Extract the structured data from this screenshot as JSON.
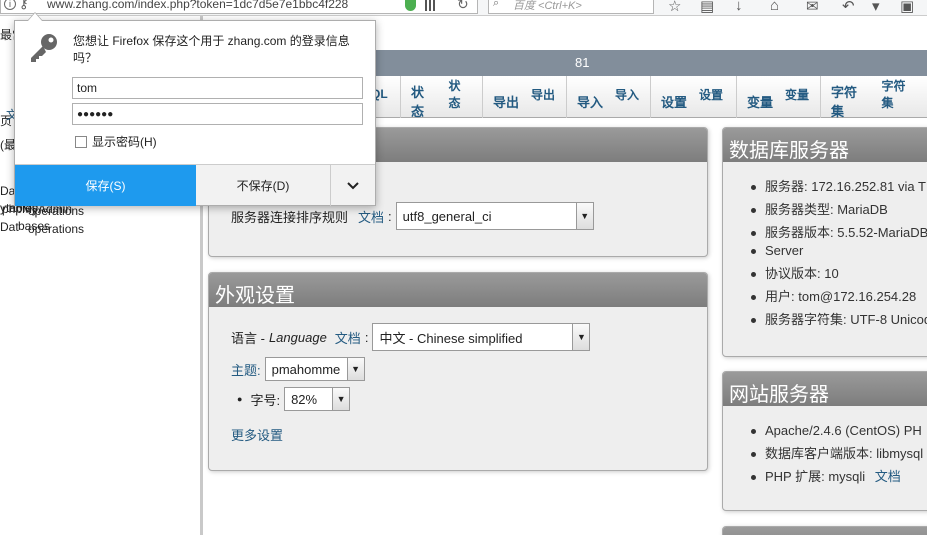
{
  "browser": {
    "url": "www.zhang.com/index.php?token=1dc7d5e7e1bbc4f228",
    "search_placeholder": "百度 <Ctrl+K>"
  },
  "nav": {
    "partial_texts": [
      "最常",
      "页",
      "文",
      "(最",
      "Dat",
      "ytables",
      "phpMyAdmin",
      "operations",
      "Dat",
      "operations",
      "bases"
    ]
  },
  "topbar": {
    "text": "81"
  },
  "tabs": [
    {
      "icon_text": "QL",
      "label": ""
    },
    {
      "icon_text": "状态",
      "label": "状态"
    },
    {
      "icon_text": "导出",
      "label": "导出"
    },
    {
      "icon_text": "导入",
      "label": "导入"
    },
    {
      "icon_text": "设置",
      "label": "设置"
    },
    {
      "icon_text": "变量",
      "label": "变量"
    },
    {
      "icon_text": "字符集",
      "label": "字符集"
    }
  ],
  "general_panel": {
    "collation_label": "服务器连接排序规则",
    "doc_link": "文档",
    "collation_value": "utf8_general_ci"
  },
  "appearance_panel": {
    "title": "外观设置",
    "language_label": "语言 - ",
    "language_label_en": "Language",
    "doc_link": "文档",
    "colon": ":",
    "language_value": "中文 - Chinese simplified",
    "theme_label": "主题:",
    "theme_value": "pmahomme",
    "font_label": "字号:",
    "font_value": "82%",
    "more_settings": "更多设置"
  },
  "db_server_panel": {
    "title": "数据库服务器",
    "items": [
      "服务器: 172.16.252.81 via T",
      "服务器类型: MariaDB",
      "服务器版本: 5.5.52-MariaDB",
      "Server",
      "协议版本: 10",
      "用户: tom@172.16.254.28",
      "服务器字符集: UTF-8 Unicod"
    ]
  },
  "web_server_panel": {
    "title": "网站服务器",
    "items": [
      "Apache/2.4.6 (CentOS) PH",
      "数据库客户端版本: libmysql",
      "PHP 扩展: mysqli"
    ],
    "doc_link": "文档"
  },
  "password_popup": {
    "message": "您想让 Firefox 保存这个用于 zhang.com 的登录信息吗？",
    "username": "tom",
    "password_mask": "●●●●●●",
    "show_password": "显示密码(H)",
    "save_button": "保存(S)",
    "dont_save_button": "不保存(D)"
  }
}
